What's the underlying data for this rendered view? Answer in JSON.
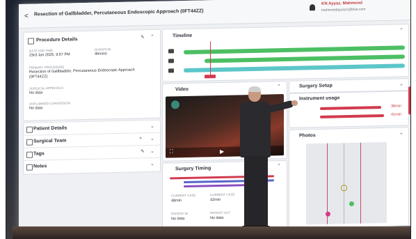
{
  "header": {
    "back": "<",
    "title": "Resection of Gallbladder, Percutaneous Endoscopic Approach (0FT44ZZ)",
    "user": "KN Ayyaz, Mahmood",
    "email": "mahmoodayyaz1@blue.com"
  },
  "procedure_details": {
    "title": "Procedure Details",
    "date_label": "DATE AND TIME",
    "date_value": "23rd Jan 2025, 9:57 PM",
    "duration_label": "DURATION",
    "duration_value": "46mins",
    "primary_label": "PRIMARY PROCEDURE",
    "primary_value": "Resection of Gallbladder, Percutaneous Endoscopic Approach (0FT44ZZ)",
    "approach_label": "SURGICAL APPROACH",
    "approach_value": "No data",
    "conversion_label": "UNPLANNED CONVERSION",
    "conversion_value": "No data"
  },
  "sections": {
    "patient": "Patient Details",
    "team": "Surgical Team",
    "tags": "Tags",
    "notes": "Notes"
  },
  "timeline": {
    "title": "Timeline"
  },
  "video": {
    "title": "Video"
  },
  "surgery_timing": {
    "title": "Surgery Timing",
    "stat1_label": "CURRENT CASE",
    "stat1_value": "48min",
    "stat2_label": "CURRENT CASE",
    "stat2_value": "42min",
    "in_label": "PATIENT IN",
    "in_value": "No data",
    "out_label": "PATIENT OUT",
    "out_value": "No data"
  },
  "surgery_setup": {
    "title": "Surgery Setup"
  },
  "instrument_usage": {
    "title": "Instrument usage",
    "value1": "39min",
    "value2": "41min"
  },
  "photos": {
    "title": "Photos"
  },
  "colors": {
    "accent": "#c63a3a",
    "green": "#4cbf63",
    "teal": "#5cc6c9",
    "marker": "#d23a4f"
  }
}
